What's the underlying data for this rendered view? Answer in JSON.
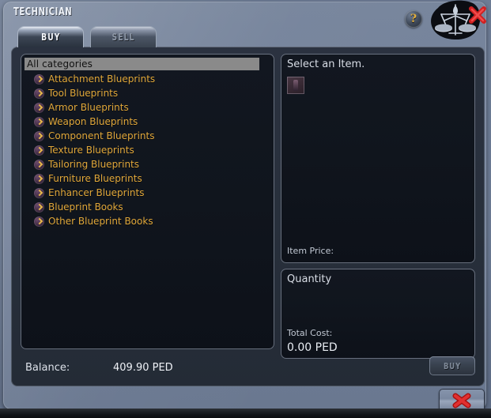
{
  "window": {
    "title": "TECHNICIAN",
    "help_icon": "question-mark-icon",
    "emblem_icon": "scales-balance-emblem",
    "title_close_icon": "close-x-icon"
  },
  "tabs": [
    {
      "id": "buy",
      "label": "BUY",
      "active": true
    },
    {
      "id": "sell",
      "label": "SELL",
      "active": false
    }
  ],
  "categories": {
    "header": "All categories",
    "bullet_icon": "arrow-right-circle-icon",
    "items": [
      {
        "label": "Attachment Blueprints"
      },
      {
        "label": "Tool Blueprints"
      },
      {
        "label": "Armor Blueprints"
      },
      {
        "label": "Weapon Blueprints"
      },
      {
        "label": "Component Blueprints"
      },
      {
        "label": "Texture Blueprints"
      },
      {
        "label": "Tailoring Blueprints"
      },
      {
        "label": "Furniture Blueprints"
      },
      {
        "label": "Enhancer Blueprints"
      },
      {
        "label": "Blueprint Books"
      },
      {
        "label": "Other Blueprint Books"
      }
    ]
  },
  "item_panel": {
    "title": "Select an Item.",
    "thumbnail_icon": "item-thumbnail-icon",
    "price_label": "Item Price:",
    "price_value": ""
  },
  "quantity_panel": {
    "title": "Quantity",
    "input_value": "",
    "input_placeholder": "",
    "total_label": "Total Cost:",
    "total_value": "0.00 PED"
  },
  "footer": {
    "balance_label": "Balance:",
    "balance_value": "409.90 PED",
    "buy_label": "BUY",
    "close_icon": "close-x-icon"
  },
  "colors": {
    "accent_gold": "#e0a73a",
    "frame_blue": "#72809a",
    "panel_dark": "#28303c",
    "box_dark": "#10151d",
    "close_red": "#d32424",
    "header_gray": "#8a8a8a"
  }
}
